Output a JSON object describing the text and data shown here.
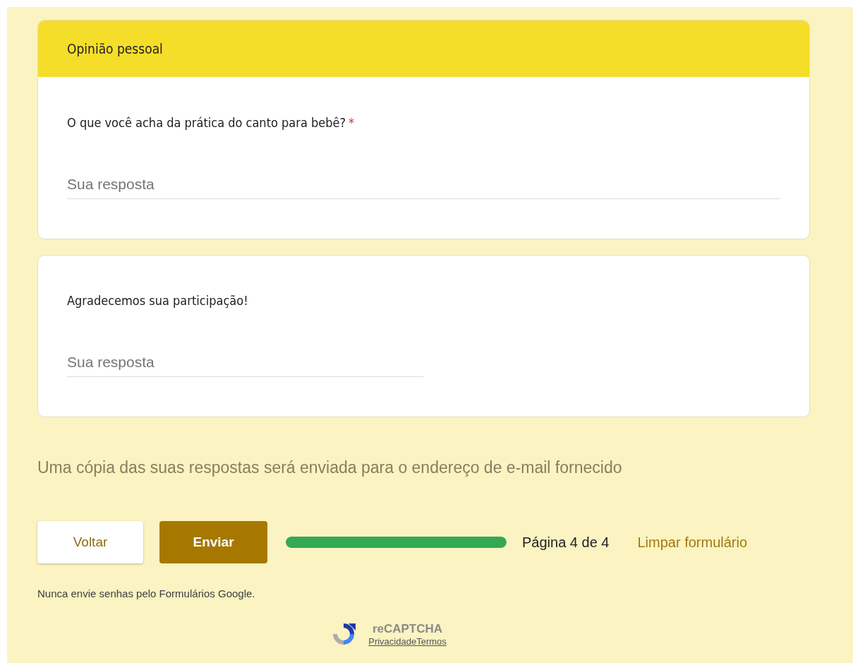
{
  "section": {
    "title": "Opinião pessoal"
  },
  "questions": [
    {
      "kind": "paragraph",
      "text": "O que você acha da prática do canto para bebê?",
      "required": true,
      "placeholder": "Sua resposta"
    },
    {
      "kind": "short",
      "text": "Agradecemos sua participação!",
      "required": false,
      "placeholder": "Sua resposta"
    }
  ],
  "required_mark": "*",
  "notice": "Uma cópia das suas respostas será enviada para o endereço de e-mail fornecido",
  "buttons": {
    "back": "Voltar",
    "submit": "Enviar"
  },
  "progress": {
    "level": 1,
    "label": "Página 4 de 4"
  },
  "clear_link": "Limpar formulário",
  "password_warning": "Nunca envie senhas pelo Formulários Google.",
  "recaptcha": {
    "name": "reCAPTCHA",
    "links": [
      "Privacidade",
      "Termos"
    ]
  }
}
